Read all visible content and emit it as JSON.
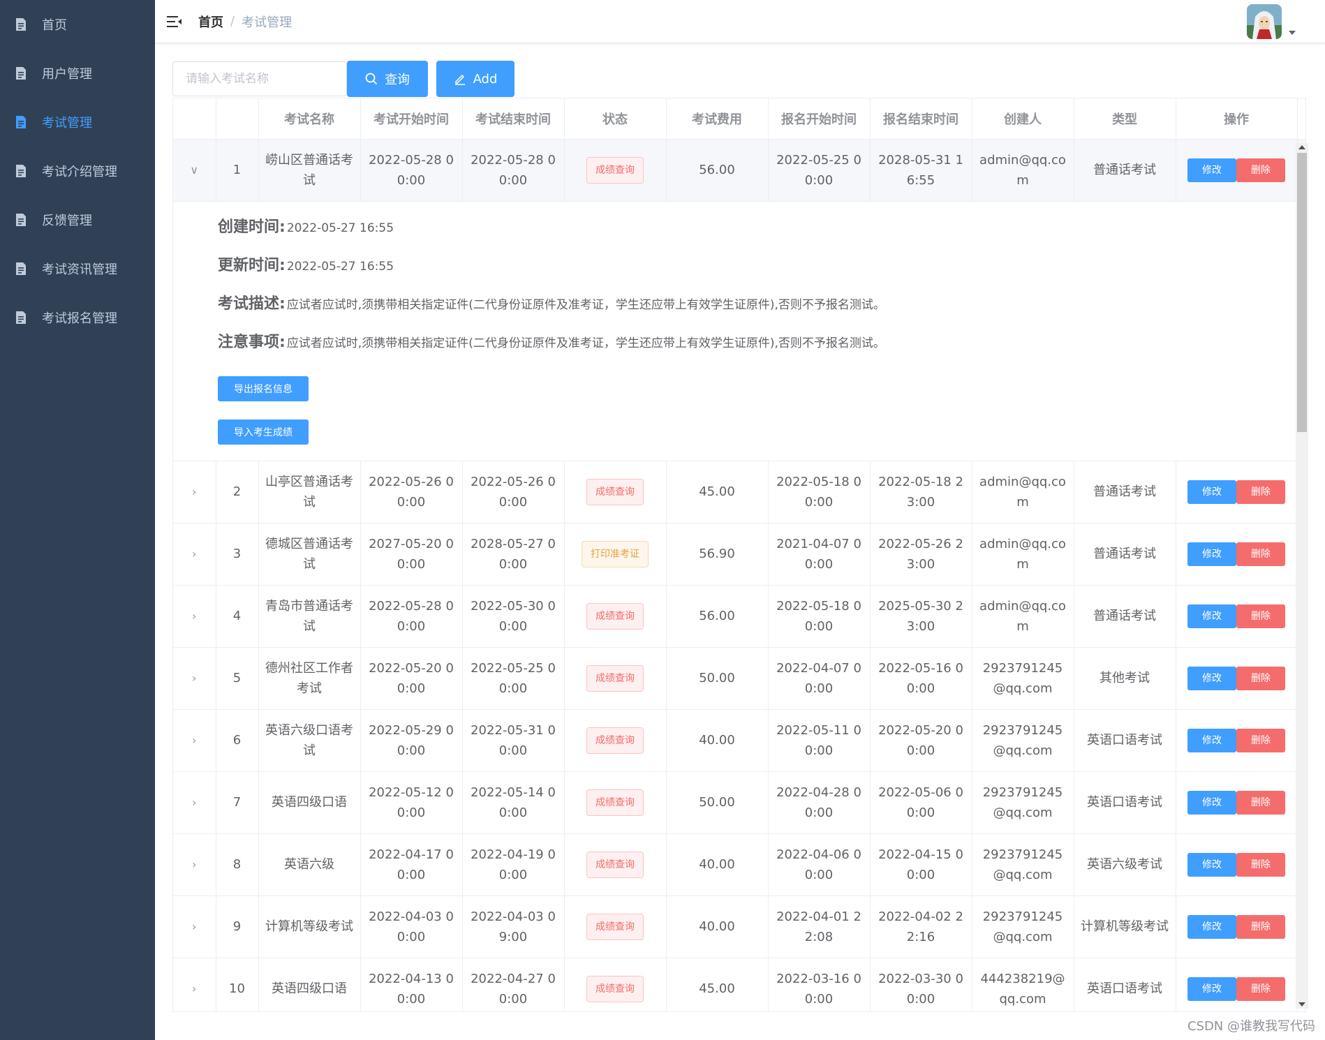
{
  "sidebar": {
    "items": [
      {
        "label": "首页",
        "icon": "document-icon"
      },
      {
        "label": "用户管理",
        "icon": "document-icon"
      },
      {
        "label": "考试管理",
        "icon": "document-icon",
        "active": true
      },
      {
        "label": "考试介绍管理",
        "icon": "document-icon"
      },
      {
        "label": "反馈管理",
        "icon": "document-icon"
      },
      {
        "label": "考试资讯管理",
        "icon": "document-icon"
      },
      {
        "label": "考试报名管理",
        "icon": "document-icon"
      }
    ],
    "bg_color": "#304156",
    "active_color": "#409eff"
  },
  "header": {
    "breadcrumb_home": "首页",
    "breadcrumb_sep": "/",
    "breadcrumb_current": "考试管理"
  },
  "toolbar": {
    "search_placeholder": "请输入考试名称",
    "search_label": "查询",
    "add_label": "Add"
  },
  "table": {
    "columns": [
      "考试名称",
      "考试开始时间",
      "考试结束时间",
      "状态",
      "考试费用",
      "报名开始时间",
      "报名结束时间",
      "创建人",
      "类型",
      "操作"
    ],
    "edit_label": "修改",
    "delete_label": "删除",
    "rows": [
      {
        "idx": "1",
        "name": "崂山区普通话考试",
        "start": "2022-05-28 00:00",
        "end": "2022-05-28 00:00",
        "status": "成绩查询",
        "status_type": "danger",
        "fee": "56.00",
        "reg_start": "2022-05-25 00:00",
        "reg_end": "2028-05-31 16:55",
        "creator": "admin@qq.com",
        "type": "普通话考试"
      },
      {
        "idx": "2",
        "name": "山亭区普通话考试",
        "start": "2022-05-26 00:00",
        "end": "2022-05-26 00:00",
        "status": "成绩查询",
        "status_type": "danger",
        "fee": "45.00",
        "reg_start": "2022-05-18 00:00",
        "reg_end": "2022-05-18 23:00",
        "creator": "admin@qq.com",
        "type": "普通话考试"
      },
      {
        "idx": "3",
        "name": "德城区普通话考试",
        "start": "2027-05-20 00:00",
        "end": "2028-05-27 00:00",
        "status": "打印准考证",
        "status_type": "warning",
        "fee": "56.90",
        "reg_start": "2021-04-07 00:00",
        "reg_end": "2022-05-26 23:00",
        "creator": "admin@qq.com",
        "type": "普通话考试"
      },
      {
        "idx": "4",
        "name": "青岛市普通话考试",
        "start": "2022-05-28 00:00",
        "end": "2022-05-30 00:00",
        "status": "成绩查询",
        "status_type": "danger",
        "fee": "56.00",
        "reg_start": "2022-05-18 00:00",
        "reg_end": "2025-05-30 23:00",
        "creator": "admin@qq.com",
        "type": "普通话考试"
      },
      {
        "idx": "5",
        "name": "德州社区工作者考试",
        "start": "2022-05-20 00:00",
        "end": "2022-05-25 00:00",
        "status": "成绩查询",
        "status_type": "danger",
        "fee": "50.00",
        "reg_start": "2022-04-07 00:00",
        "reg_end": "2022-05-16 00:00",
        "creator": "2923791245@qq.com",
        "type": "其他考试"
      },
      {
        "idx": "6",
        "name": "英语六级口语考试",
        "start": "2022-05-29 00:00",
        "end": "2022-05-31 00:00",
        "status": "成绩查询",
        "status_type": "danger",
        "fee": "40.00",
        "reg_start": "2022-05-11 00:00",
        "reg_end": "2022-05-20 00:00",
        "creator": "2923791245@qq.com",
        "type": "英语口语考试"
      },
      {
        "idx": "7",
        "name": "英语四级口语",
        "start": "2022-05-12 00:00",
        "end": "2022-05-14 00:00",
        "status": "成绩查询",
        "status_type": "danger",
        "fee": "50.00",
        "reg_start": "2022-04-28 00:00",
        "reg_end": "2022-05-06 00:00",
        "creator": "2923791245@qq.com",
        "type": "英语口语考试"
      },
      {
        "idx": "8",
        "name": "英语六级",
        "start": "2022-04-17 00:00",
        "end": "2022-04-19 00:00",
        "status": "成绩查询",
        "status_type": "danger",
        "fee": "40.00",
        "reg_start": "2022-04-06 00:00",
        "reg_end": "2022-04-15 00:00",
        "creator": "2923791245@qq.com",
        "type": "英语六级考试"
      },
      {
        "idx": "9",
        "name": "计算机等级考试",
        "start": "2022-04-03 00:00",
        "end": "2022-04-03 09:00",
        "status": "成绩查询",
        "status_type": "danger",
        "fee": "40.00",
        "reg_start": "2022-04-01 22:08",
        "reg_end": "2022-04-02 22:16",
        "creator": "2923791245@qq.com",
        "type": "计算机等级考试"
      },
      {
        "idx": "10",
        "name": "英语四级口语",
        "start": "2022-04-13 00:00",
        "end": "2022-04-27 00:00",
        "status": "成绩查询",
        "status_type": "danger",
        "fee": "45.00",
        "reg_start": "2022-03-16 00:00",
        "reg_end": "2022-03-30 00:00",
        "creator": "444238219@qq.com",
        "type": "英语口语考试"
      }
    ],
    "expanded": {
      "created_label": "创建时间:",
      "created_value": "2022-05-27 16:55",
      "updated_label": "更新时间:",
      "updated_value": "2022-05-27 16:55",
      "desc_label": "考试描述:",
      "desc_value": "应试者应试时,须携带相关指定证件(二代身份证原件及准考证，学生还应带上有效学生证原件),否则不予报名测试。",
      "notice_label": "注意事项:",
      "notice_value": "应试者应试时,须携带相关指定证件(二代身份证原件及准考证，学生还应带上有效学生证原件),否则不予报名测试。",
      "export_label": "导出报名信息",
      "import_label": "导入考生成绩"
    }
  },
  "watermark": "CSDN @谁教我写代码"
}
